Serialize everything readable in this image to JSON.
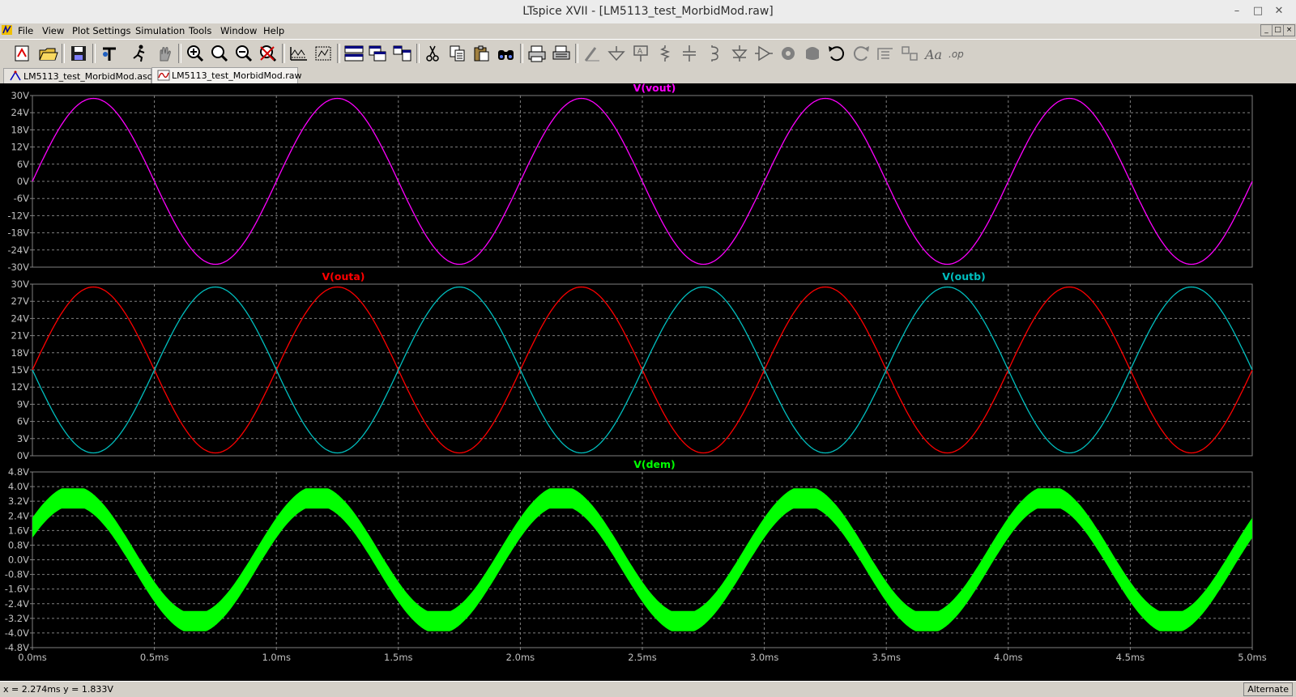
{
  "window": {
    "title": "LTspice XVII - [LM5113_test_MorbidMod.raw]",
    "minimize_glyph": "–",
    "restore_glyph": "□",
    "close_glyph": "✕"
  },
  "menu": {
    "items": [
      "File",
      "View",
      "Plot Settings",
      "Simulation",
      "Tools",
      "Window",
      "Help"
    ],
    "mdi_buttons": [
      "_",
      "□",
      "×"
    ]
  },
  "toolbar": {
    "icons": [
      "new-schematic-icon",
      "open-icon",
      "save-icon",
      "control-panel-icon",
      "run-icon",
      "halt-icon",
      "zoom-in-icon",
      "zoom-full-icon",
      "zoom-out-icon",
      "zoom-cancel-icon",
      "autorange-icon",
      "manual-limits-icon",
      "tile-horizontal-icon",
      "cascade-icon",
      "tile-vertical-icon",
      "cut-icon",
      "copy-icon",
      "paste-icon",
      "find-icon",
      "print-icon",
      "print-setup-icon",
      "wire-icon",
      "ground-icon",
      "label-net-icon",
      "resistor-icon",
      "capacitor-icon",
      "inductor-icon",
      "diode-icon",
      "component-icon",
      "rotate-icon",
      "mirror-icon",
      "undo-icon",
      "redo-icon",
      "move-icon",
      "drag-icon",
      "text-icon",
      "spice-directive-icon"
    ]
  },
  "tabs": [
    {
      "label": "LM5113_test_MorbidMod.asc",
      "icon": "schematic-icon",
      "active": false
    },
    {
      "label": "LM5113_test_MorbidMod.raw",
      "icon": "waveform-icon",
      "active": true
    }
  ],
  "chart_data": [
    {
      "type": "line",
      "title": "",
      "series": [
        {
          "name": "V(vout)",
          "color": "#ff00ff",
          "amplitude": 29,
          "offset": 0,
          "freq_khz": 1,
          "phase_deg": 0
        }
      ],
      "ylim": [
        -30,
        30
      ],
      "yticks": [
        "30V",
        "24V",
        "18V",
        "12V",
        "6V",
        "0V",
        "-6V",
        "-12V",
        "-18V",
        "-24V",
        "-30V"
      ],
      "xlim": [
        0,
        5
      ],
      "x_unit": "ms"
    },
    {
      "type": "line",
      "title": "",
      "series": [
        {
          "name": "V(outa)",
          "color": "#ff0000",
          "amplitude": 14.5,
          "offset": 15,
          "freq_khz": 1,
          "phase_deg": 0
        },
        {
          "name": "V(outb)",
          "color": "#00bfbf",
          "amplitude": 14.5,
          "offset": 15,
          "freq_khz": 1,
          "phase_deg": 180
        }
      ],
      "ylim": [
        0,
        30
      ],
      "yticks": [
        "30V",
        "27V",
        "24V",
        "21V",
        "18V",
        "15V",
        "12V",
        "9V",
        "6V",
        "3V",
        "0V"
      ],
      "xlim": [
        0,
        5
      ],
      "x_unit": "ms"
    },
    {
      "type": "area",
      "title": "",
      "series": [
        {
          "name": "V(dem)",
          "color": "#00ff00",
          "center_amplitude": 3.5,
          "band_half_width": 0.55,
          "freq_khz": 1,
          "phase_deg": 30
        }
      ],
      "ylim": [
        -4.8,
        4.8
      ],
      "yticks": [
        "4.8V",
        "4.0V",
        "3.2V",
        "2.4V",
        "1.6V",
        "0.8V",
        "0.0V",
        "-0.8V",
        "-1.6V",
        "-2.4V",
        "-3.2V",
        "-4.0V",
        "-4.8V"
      ],
      "xlim": [
        0,
        5
      ],
      "xticks": [
        "0.0ms",
        "0.5ms",
        "1.0ms",
        "1.5ms",
        "2.0ms",
        "2.5ms",
        "3.0ms",
        "3.5ms",
        "4.0ms",
        "4.5ms",
        "5.0ms"
      ],
      "x_unit": "ms"
    }
  ],
  "status": {
    "cursor": "x = 2.274ms    y = 1.833V",
    "mode": "Alternate"
  }
}
